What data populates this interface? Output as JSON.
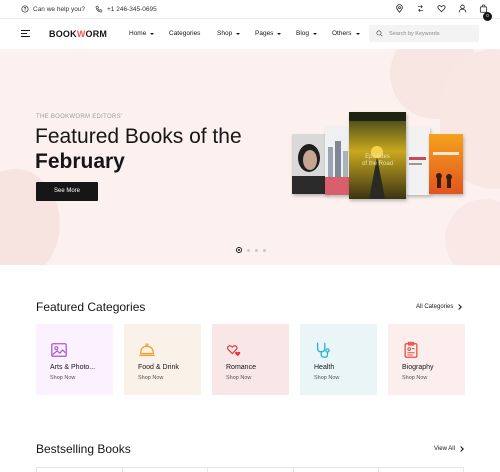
{
  "topbar": {
    "help_text": "Can we help you?",
    "phone": "+1 246-345-0695",
    "cart_count": "0"
  },
  "header": {
    "logo_part1": "BOOK",
    "logo_accent": "W",
    "logo_part2": "ORM",
    "nav": [
      {
        "label": "Home",
        "dropdown": true
      },
      {
        "label": "Categories",
        "dropdown": false
      },
      {
        "label": "Shop",
        "dropdown": true
      },
      {
        "label": "Pages",
        "dropdown": true
      },
      {
        "label": "Blog",
        "dropdown": true
      },
      {
        "label": "Others",
        "dropdown": true
      }
    ],
    "search_placeholder": "Search by Keywords"
  },
  "hero": {
    "eyebrow": "THE BOOKWORM EDITORS'",
    "title_line1": "Featured Books of the",
    "title_line2": "February",
    "cta_label": "See More",
    "featured_book_title": "Episodes of the Road",
    "slides_total": 4,
    "active_slide": 1,
    "colors": {
      "background": "#fcf1ef",
      "accent": "#f75454"
    }
  },
  "categories": {
    "title": "Featured Categories",
    "link_label": "All Categories",
    "items": [
      {
        "name": "Arts & Photo...",
        "action": "Shop Now",
        "icon": "image-frame-icon",
        "bg": "#fbf1ff",
        "color": "#a855d6"
      },
      {
        "name": "Food & Drink",
        "action": "Shop Now",
        "icon": "cloche-icon",
        "bg": "#faf1e8",
        "color": "#f39c2c"
      },
      {
        "name": "Romance",
        "action": "Shop Now",
        "icon": "hearts-icon",
        "bg": "#f8e7e6",
        "color": "#e23a3a"
      },
      {
        "name": "Health",
        "action": "Shop Now",
        "icon": "stethoscope-icon",
        "bg": "#e9f5f7",
        "color": "#1db1d6"
      },
      {
        "name": "Biography",
        "action": "Shop Now",
        "icon": "clipboard-icon",
        "bg": "#fdeeee",
        "color": "#e74c3c"
      }
    ]
  },
  "bestselling": {
    "title": "Bestselling Books",
    "link_label": "View All"
  }
}
